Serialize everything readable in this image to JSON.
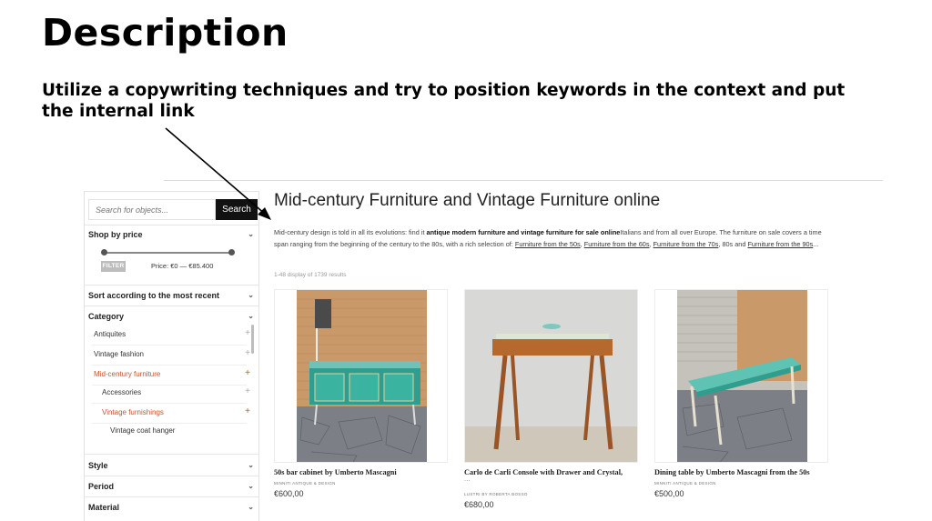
{
  "slide": {
    "title": "Description",
    "subtitle": "Utilize a copywriting techniques and try to position keywords in the context and put the internal link"
  },
  "search": {
    "placeholder": "Search for objects...",
    "button": "Search"
  },
  "filters": {
    "shop_by_price": "Shop by price",
    "filter_button": "FILTER",
    "price_range": "Price: €0 — €85.400",
    "sort": "Sort according to the most recent",
    "category": "Category",
    "category_items": [
      {
        "label": "Antiquites"
      },
      {
        "label": "Vintage fashion"
      },
      {
        "label": "Mid-century furniture"
      },
      {
        "label": "Accessories"
      },
      {
        "label": "Vintage furnishings"
      },
      {
        "label": "Vintage coat hanger"
      }
    ],
    "style": "Style",
    "period": "Period",
    "material": "Material"
  },
  "main": {
    "title": "Mid-century Furniture and Vintage Furniture online",
    "desc_intro": "Mid-century design is told in all its evolutions: find it ",
    "desc_bold": "antique modern furniture and vintage furniture for sale online",
    "desc_mid": "Italians and from all over Europe. The furniture on sale covers a time span ranging from the beginning of the century to the 80s, with a rich selection of: ",
    "links": [
      "Furniture from the 50s",
      "Furniture from the 60s",
      "Furniture from the 70s",
      "Furniture from the 90s"
    ],
    "sep1": ", ",
    "sep2": ", ",
    "sep3": ", 80s and ",
    "desc_end": "...",
    "results": "1-48 display of 1739 results"
  },
  "products": [
    {
      "name": "50s bar cabinet by Umberto Mascagni",
      "seller": "MINNITI ANTIQUE & DESIGN",
      "price": "€600,00"
    },
    {
      "name": "Carlo de Carli Console with Drawer and Crystal,",
      "name_cont": "...",
      "seller": "LUSTRI BY ROBERTA BOSSO",
      "price": "€680,00"
    },
    {
      "name": "Dining table by Umberto Mascagni from the 50s",
      "seller": "MINNITI ANTIQUE & DESIGN",
      "price": "€500,00"
    }
  ],
  "colors": {
    "accent_red": "#c8532f",
    "button_dark": "#111111",
    "teal": "#3aa89a"
  },
  "icons": [
    "chevron-down-icon",
    "plus-icon"
  ]
}
